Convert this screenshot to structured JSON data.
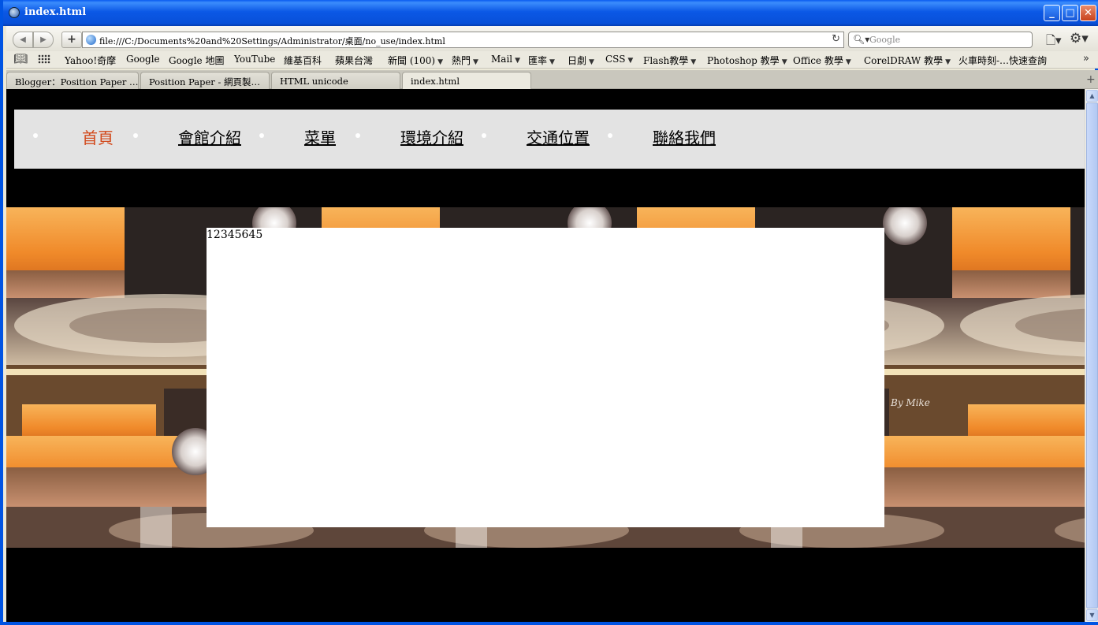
{
  "window": {
    "title": "index.html",
    "minimize": "_",
    "maximize": "□",
    "close": "✕"
  },
  "toolbar": {
    "back_icon": "◀",
    "forward_icon": "▶",
    "add_icon": "+",
    "url": "file:///C:/Documents%20and%20Settings/Administrator/桌面/no_use/index.html",
    "reload_icon": "↻",
    "search_icon": "🔍︎▾",
    "search_placeholder": "Google",
    "page_icon": "🗋▾",
    "gear_icon": "⚙▾"
  },
  "bookmarks": {
    "book_icon": "📖︎",
    "items": [
      {
        "label": "Yahoo!奇摩",
        "dropdown": ""
      },
      {
        "label": "Google",
        "dropdown": ""
      },
      {
        "label": "Google 地圖",
        "dropdown": ""
      },
      {
        "label": "YouTube",
        "dropdown": ""
      },
      {
        "label": "維基百科",
        "dropdown": ""
      },
      {
        "label": "蘋果台灣",
        "dropdown": ""
      },
      {
        "label": "新聞 (100)",
        "dropdown": "▼"
      },
      {
        "label": "熱門",
        "dropdown": "▼"
      },
      {
        "label": "Mail",
        "dropdown": "▼"
      },
      {
        "label": "匯率",
        "dropdown": "▼"
      },
      {
        "label": "日劇",
        "dropdown": "▼"
      },
      {
        "label": "CSS",
        "dropdown": "▼"
      },
      {
        "label": "Flash教學",
        "dropdown": "▼"
      },
      {
        "label": "Photoshop 教學",
        "dropdown": "▼"
      },
      {
        "label": "Office 教學",
        "dropdown": "▼"
      },
      {
        "label": "CorelDRAW 教學",
        "dropdown": "▼"
      },
      {
        "label": "火車時刻-…快速查詢",
        "dropdown": ""
      }
    ],
    "more_icon": "»"
  },
  "tabs": [
    {
      "label": "Blogger：Position Paper …"
    },
    {
      "label": "Position Paper - 網頁製…"
    },
    {
      "label": "HTML unicode"
    },
    {
      "label": "index.html"
    }
  ],
  "tab_add": "+",
  "page": {
    "menu": [
      {
        "label": "首頁"
      },
      {
        "label": "會館介紹"
      },
      {
        "label": "菜單"
      },
      {
        "label": "環境介紹"
      },
      {
        "label": "交通位置"
      },
      {
        "label": "聯絡我們"
      }
    ],
    "active_color": "#d2491b",
    "panel_text": "12345645",
    "signature": "By Mike"
  },
  "scrollbar": {
    "up_icon": "▲",
    "down_icon": "▼"
  }
}
